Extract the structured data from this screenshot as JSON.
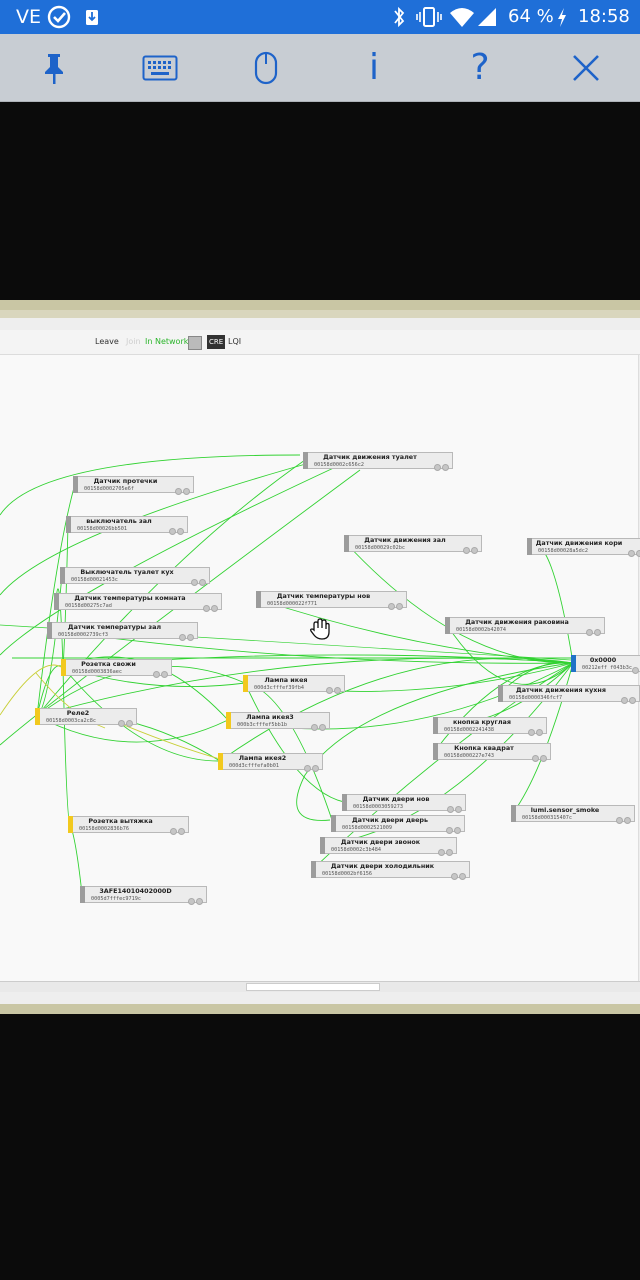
{
  "statusbar": {
    "carrier": "VE",
    "battery": "64 %",
    "time": "18:58"
  },
  "toolbar": {
    "buttons": [
      "pin-icon",
      "keyboard-icon",
      "mouse-icon",
      "info-icon",
      "help-icon",
      "close-icon"
    ],
    "info_glyph": "i",
    "help_glyph": "?"
  },
  "remote_toolbar": {
    "leave": "Leave",
    "join": "Join",
    "in_network": "In Network",
    "cre": "CRE",
    "lqi": "LQI"
  },
  "colors": {
    "statusbar": "#1f6fd8",
    "toolbar": "#c8cdd3",
    "accent": "#1e63c9",
    "link": "#32d232"
  },
  "nodes": [
    {
      "name": "Датчик движения туалет",
      "addr": "00158d0002c656c2",
      "status": "gray"
    },
    {
      "name": "Датчик протечки",
      "addr": "00158d0002705e6f",
      "status": "gray"
    },
    {
      "name": "выключатель зал",
      "addr": "00158d00026bb501",
      "status": "gray"
    },
    {
      "name": "Датчик движения зал",
      "addr": "00158d00029c02bc",
      "status": "gray"
    },
    {
      "name": "Датчик движения кори",
      "addr": "00158d00028a5dc2",
      "status": "gray"
    },
    {
      "name": "Выключатель туалет кух",
      "addr": "00158d00021453c",
      "status": "gray"
    },
    {
      "name": "Датчик температуры нов",
      "addr": "00158d000022f771",
      "status": "gray"
    },
    {
      "name": "Датчик температуры комната",
      "addr": "00158d00275c7ad",
      "status": "gray"
    },
    {
      "name": "Датчик температуры зал",
      "addr": "00158d0002739cf3",
      "status": "gray"
    },
    {
      "name": "Датчик движения раковина",
      "addr": "00158d0002b42074",
      "status": "gray"
    },
    {
      "name": "0x0000",
      "addr": "00212eff f043b3c",
      "status": "blue"
    },
    {
      "name": "Розетка свожи",
      "addr": "00158d0003836aec",
      "status": "yellow"
    },
    {
      "name": "Лампа икея",
      "addr": "000d3cfffef39fb4",
      "status": "yellow"
    },
    {
      "name": "Датчик движения кухня",
      "addr": "00158d0000346fcf7",
      "status": "gray"
    },
    {
      "name": "Реле2",
      "addr": "00158d0003ca2c8c",
      "status": "yellow"
    },
    {
      "name": "Лампа икея3",
      "addr": "000b3cfffef5bb1b",
      "status": "yellow"
    },
    {
      "name": "кнопка круглая",
      "addr": "00158d0002241438",
      "status": "gray"
    },
    {
      "name": "Лампа икея2",
      "addr": "000d3cfffefa0b01",
      "status": "yellow"
    },
    {
      "name": "Кнопка квадрат",
      "addr": "00158d000227e743",
      "status": "gray"
    },
    {
      "name": "Датчик двери нов",
      "addr": "00158d0003059273",
      "status": "gray"
    },
    {
      "name": "lumi.sensor_smoke",
      "addr": "00158d000315407c",
      "status": "gray"
    },
    {
      "name": "Датчик двери дверь",
      "addr": "00158d0002521009",
      "status": "gray"
    },
    {
      "name": "Розетка вытяжка",
      "addr": "00158d0002836b76",
      "status": "yellow"
    },
    {
      "name": "Датчик двери звонок",
      "addr": "00158d0002c3b484",
      "status": "gray"
    },
    {
      "name": "Датчик двери холодильник",
      "addr": "00158d0002bf6156",
      "status": "gray"
    },
    {
      "name": "3AFE14010402000D",
      "addr": "0005d7fffec9719c",
      "status": "gray"
    }
  ]
}
